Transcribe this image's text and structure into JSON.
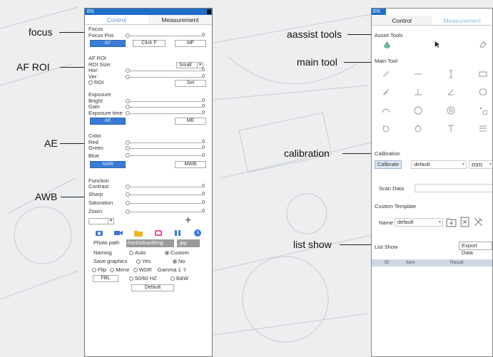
{
  "callouts": {
    "focus": "focus",
    "af_roi": "AF ROI",
    "ae": "AE",
    "awb": "AWB",
    "assist_tools": "aassist tools",
    "main_tool": "main tool",
    "calibration": "calibration",
    "list_show": "list show"
  },
  "left_panel": {
    "lang": "EN",
    "tab_control": "Control",
    "tab_measurement": "Measurement",
    "focus": {
      "heading": "Focus",
      "pos_label": "Focus Pos",
      "pos_value": "0",
      "btn_af": "AF",
      "btn_click_f": "Click F",
      "btn_mf": "MF"
    },
    "af_roi": {
      "heading": "AF ROI",
      "size_label": "ROI Size:",
      "size_value": "Small",
      "hor_label": "Hor:",
      "hor_value": "0",
      "ver_label": "Ver:",
      "ver_value": "0",
      "roi_label": "ROI",
      "set_button": "Set"
    },
    "exposure": {
      "heading": "Exposure",
      "bright_label": "Bright",
      "bright_value": "0",
      "gain_label": "Gain",
      "gain_value": "0",
      "time_label": "Exposure time",
      "time_value": "0",
      "btn_ae": "AE",
      "btn_me": "ME"
    },
    "color": {
      "heading": "Color",
      "red_label": "Red",
      "red_value": "0",
      "green_label": "Green",
      "green_value": "0",
      "blue_label": "Blue",
      "blue_value": "0",
      "btn_awb": "AWB",
      "btn_mwb": "MWB"
    },
    "function": {
      "heading": "Function",
      "contrast_label": "Contrast",
      "contrast_value": "0",
      "sharp_label": "Sharp",
      "sharp_value": "0",
      "saturation_label": "Saturation",
      "saturation_value": "0",
      "zoom_label": "Zoom",
      "zoom_value": "0",
      "plus_symbol": "+"
    },
    "photo_path_label": "Photo path",
    "photo_path_value": "/mnt/sdcard/img",
    "format_value": ".jpg",
    "naming_label": "Naming",
    "naming_auto": "Auto",
    "naming_custom": "Custom",
    "save_graphics_label": "Save graphics",
    "save_yes": "Yes",
    "save_no": "No",
    "flip": "Flip",
    "mirror": "Mirror",
    "wdr": "WDR",
    "gamma_label": "Gamma 1",
    "fbl": "FBL",
    "hz": "50/60 HZ",
    "bw": "B&W",
    "default_button": "Default",
    "colors": {
      "accent": "#3a7bd5",
      "titlebar": "#1f6fc9"
    }
  },
  "right_panel": {
    "lang": "EN",
    "tab_control": "Control",
    "tab_measurement": "Measurement",
    "assist_heading": "Assist Tools",
    "main_heading": "Main Tool",
    "calibration_heading": "Calibration",
    "calibrate_button": "Calibrate",
    "calibrate_value": "default",
    "unit_value": "mm",
    "scan_data_label": "Scan Data",
    "custom_template_heading": "Custom Template",
    "name_label": "Name",
    "name_value": "default",
    "list_show_label": "List Show",
    "export_button": "Export Data",
    "table_headers": [
      "ID",
      "Item",
      "Result"
    ],
    "main_tool_icons": [
      "line-icon",
      "horizontal-line-icon",
      "vertical-line-icon",
      "rectangle-icon",
      "angle-icon",
      "perpendicular-icon",
      "angle2-icon",
      "hexagon-icon",
      "arc-icon",
      "circle-icon",
      "concentric-circle-icon",
      "points-icon",
      "circle-center-icon",
      "two-circle-icon",
      "text-icon",
      "parallel-lines-icon"
    ]
  }
}
